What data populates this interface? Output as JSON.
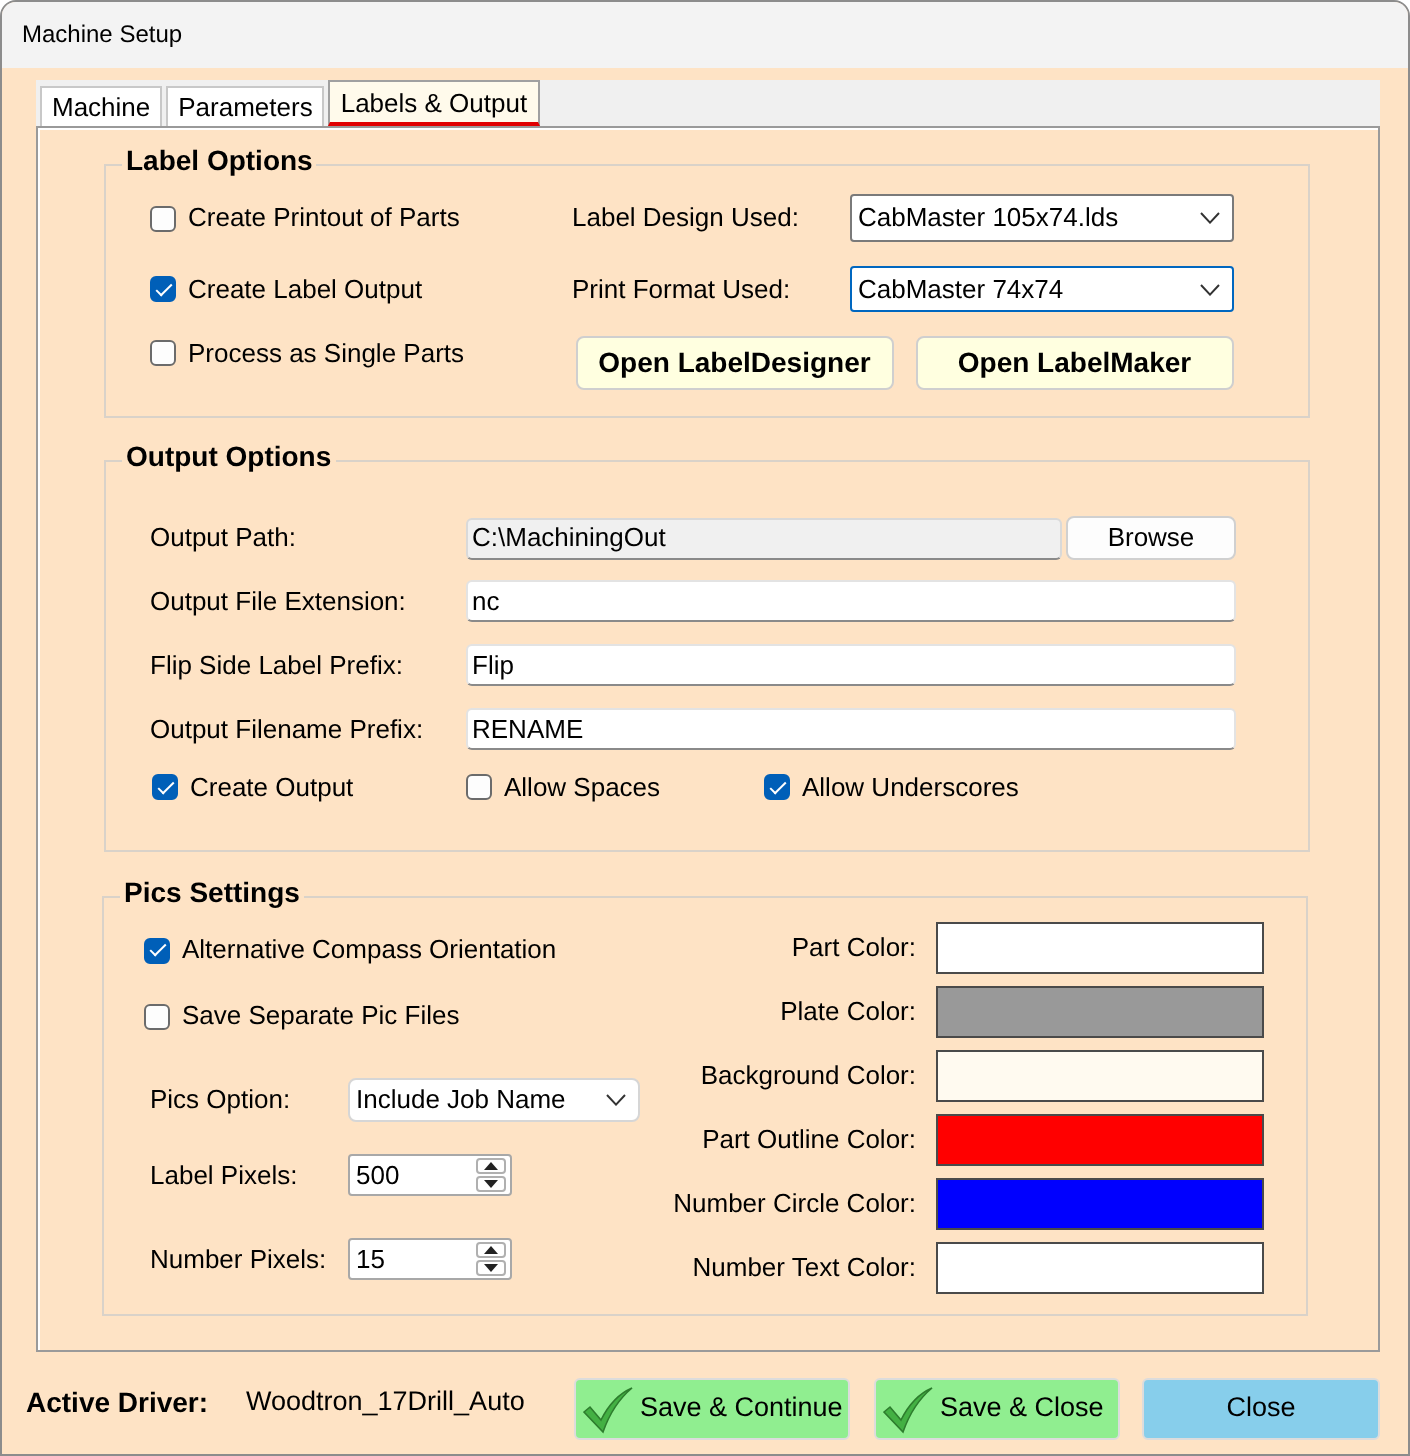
{
  "window": {
    "title": "Machine Setup"
  },
  "tabs": [
    {
      "label": "Machine",
      "selected": false
    },
    {
      "label": "Parameters",
      "selected": false
    },
    {
      "label": "Labels & Output",
      "selected": true
    }
  ],
  "label_options": {
    "title": "Label Options",
    "checkboxes": [
      {
        "label": "Create Printout of Parts",
        "checked": false
      },
      {
        "label": "Create Label Output",
        "checked": true
      },
      {
        "label": "Process as Single Parts",
        "checked": false
      }
    ],
    "dropdowns": [
      {
        "label": "Label Design Used:",
        "value": "CabMaster 105x74.lds",
        "focused": false
      },
      {
        "label": "Print Format Used:",
        "value": "CabMaster 74x74",
        "focused": true
      }
    ],
    "buttons": [
      "Open LabelDesigner",
      "Open LabelMaker"
    ]
  },
  "output_options": {
    "title": "Output Options",
    "fields": [
      {
        "label": "Output Path:",
        "value": "C:\\MachiningOut",
        "readonly": true,
        "button": "Browse"
      },
      {
        "label": "Output File Extension:",
        "value": "nc",
        "readonly": false
      },
      {
        "label": "Flip Side Label Prefix:",
        "value": "Flip",
        "readonly": false
      },
      {
        "label": "Output Filename Prefix:",
        "value": "RENAME",
        "readonly": false
      }
    ],
    "checkboxes": [
      {
        "label": "Create Output",
        "checked": true
      },
      {
        "label": "Allow Spaces",
        "checked": false
      },
      {
        "label": "Allow Underscores",
        "checked": true
      }
    ]
  },
  "pics_settings": {
    "title": "Pics Settings",
    "checkboxes": [
      {
        "label": "Alternative Compass Orientation",
        "checked": true
      },
      {
        "label": "Save Separate Pic Files",
        "checked": false
      }
    ],
    "controls": [
      {
        "kind": "dropdown",
        "label": "Pics Option:",
        "value": "Include Job Name"
      },
      {
        "kind": "spinner",
        "label": "Label Pixels:",
        "value": "500"
      },
      {
        "kind": "spinner",
        "label": "Number Pixels:",
        "value": "15"
      }
    ],
    "colors": [
      {
        "label": "Part Color:",
        "color": "#ffffff"
      },
      {
        "label": "Plate Color:",
        "color": "#999999"
      },
      {
        "label": "Background Color:",
        "color": "#fffaf0"
      },
      {
        "label": "Part Outline Color:",
        "color": "#ff0000"
      },
      {
        "label": "Number Circle Color:",
        "color": "#0000ff"
      },
      {
        "label": "Number Text Color:",
        "color": "#ffffff"
      }
    ]
  },
  "footer": {
    "driver_label": "Active Driver:",
    "driver": "Woodtron_17Drill_Auto",
    "buttons": [
      {
        "label": "Save & Continue",
        "kind": "confirm"
      },
      {
        "label": "Save & Close",
        "kind": "confirm"
      },
      {
        "label": "Close",
        "kind": "cancel"
      }
    ]
  }
}
